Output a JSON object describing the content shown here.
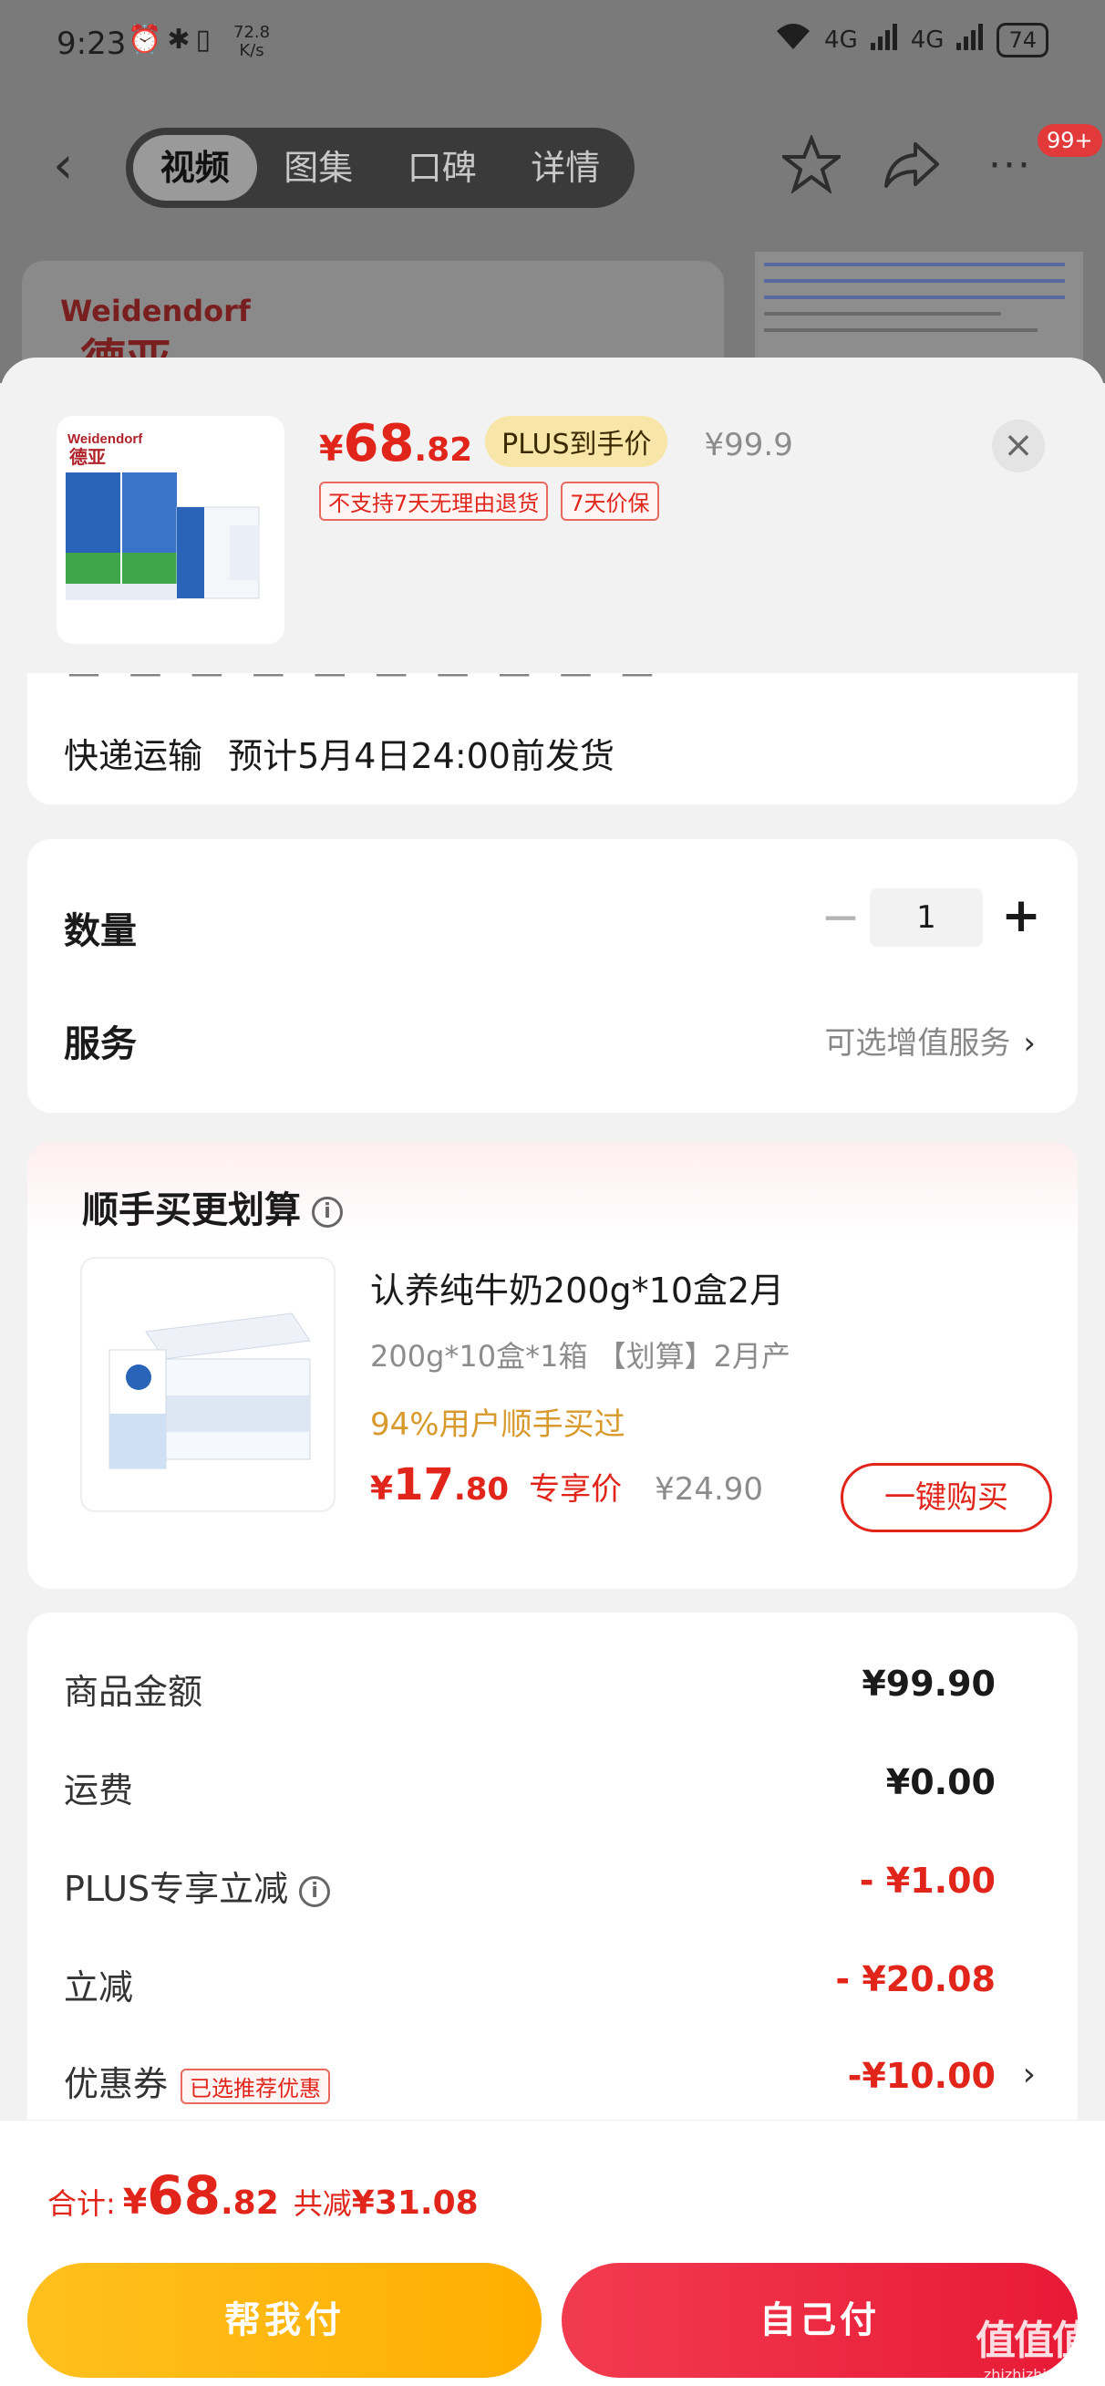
{
  "status_bar": {
    "time": "9:23",
    "speed": "72.8\nK/s",
    "net1": "4G",
    "net2": "4G",
    "battery": "74"
  },
  "nav": {
    "tabs": [
      {
        "label": "视频"
      },
      {
        "label": "图集"
      },
      {
        "label": "口碑"
      },
      {
        "label": "详情"
      }
    ],
    "badge": "99+"
  },
  "background": {
    "brand": "Weidendorf",
    "brand_cn": "德亚"
  },
  "product": {
    "price_symbol": "¥",
    "price_int": "68",
    "price_dec": ".82",
    "plus_tag": "PLUS到手价",
    "original_price": "¥99.9",
    "tags": [
      "不支持7天无理由退货",
      "7天价保"
    ],
    "thumb_brand": "Weidendorf",
    "thumb_brand_cn": "德亚"
  },
  "delivery": {
    "method": "快递运输",
    "estimate": "预计5月4日24:00前发货"
  },
  "quantity": {
    "label": "数量",
    "value": "1",
    "minus": "−",
    "plus": "+"
  },
  "service": {
    "label": "服务",
    "value": "可选增值服务",
    "chevron": "›"
  },
  "upsell": {
    "title": "顺手买更划算",
    "name": "认养纯牛奶200g*10盒2月",
    "spec": "200g*10盒*1箱 【划算】2月产",
    "social": "94%用户顺手买过",
    "price_symbol": "¥",
    "price_int": "17",
    "price_dec": ".80",
    "price_label": "专享价",
    "original_price": "¥24.90",
    "buy_button": "一键购买"
  },
  "amounts": [
    {
      "label": "商品金额",
      "value": "¥99.90",
      "red": false
    },
    {
      "label": "运费",
      "value": "¥0.00",
      "red": false
    },
    {
      "label": "PLUS专享立减",
      "value": "- ¥1.00",
      "red": true
    },
    {
      "label": "立减",
      "value": "- ¥20.08",
      "red": true
    },
    {
      "label": "优惠券",
      "value": "-¥10.00",
      "red": true,
      "tag": "已选推荐优惠"
    }
  ],
  "footer": {
    "total_label": "合计:",
    "total_symbol": "¥",
    "total_int": "68",
    "total_dec": ".82",
    "saved_label": "共减",
    "saved_value": "¥31.08",
    "help_pay": "帮我付",
    "self_pay": "自己付",
    "watermark_logo": "值值值",
    "watermark_url": "zhizhizhi.com"
  },
  "colors": {
    "accent_red": "#e1251b",
    "plus_gold": "#f8e6a8",
    "help_yellow": "#ffb800",
    "pay_red": "#ec2a42"
  }
}
